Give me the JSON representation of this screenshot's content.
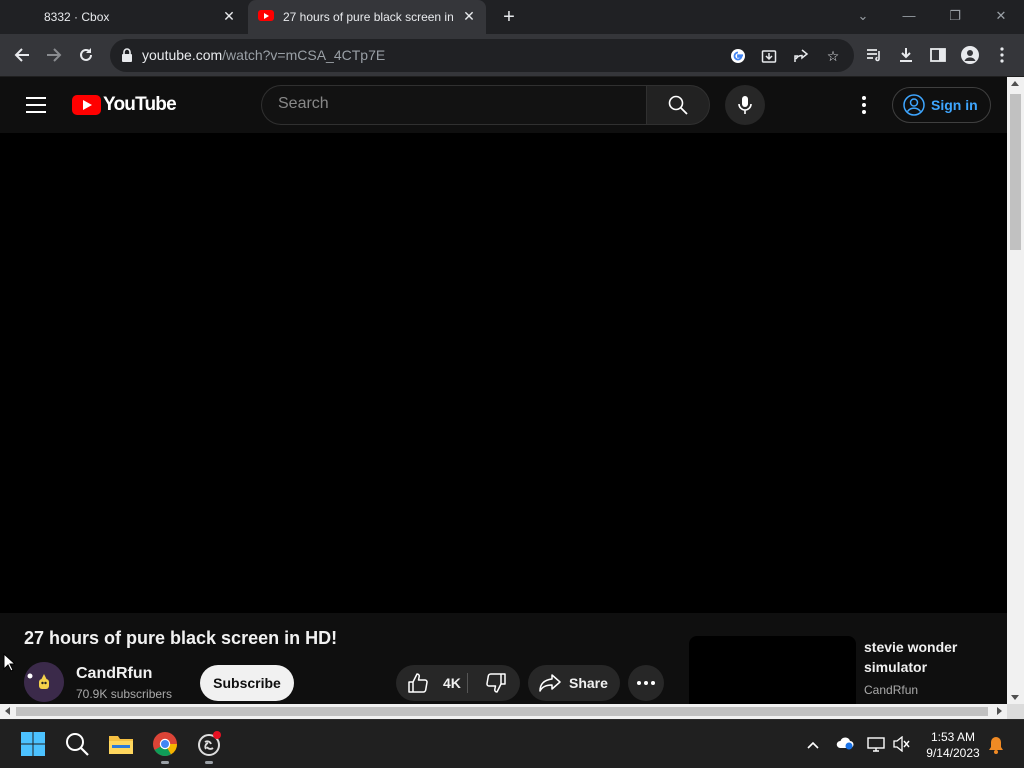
{
  "browser": {
    "tabs": [
      {
        "title": "8332 · Cbox",
        "active": false
      },
      {
        "title": "27 hours of pure black screen in HD!",
        "active": true
      }
    ],
    "url_host": "youtube.com",
    "url_path": "/watch?v=mCSA_4CTp7E"
  },
  "youtube": {
    "logo_text": "YouTube",
    "search_placeholder": "Search",
    "sign_in_label": "Sign in",
    "video": {
      "title": "27 hours of pure black screen in HD!",
      "channel": "CandRfun",
      "subscribers": "70.9K subscribers",
      "subscribe_label": "Subscribe",
      "likes": "4K",
      "share_label": "Share"
    },
    "recommendation": {
      "title": "stevie wonder simulator",
      "channel": "CandRfun"
    }
  },
  "taskbar": {
    "time": "1:53 AM",
    "date": "9/14/2023"
  },
  "colors": {
    "brand_red": "#ff0000",
    "link_blue": "#3ea6ff",
    "page_bg": "#0f0f0f"
  }
}
